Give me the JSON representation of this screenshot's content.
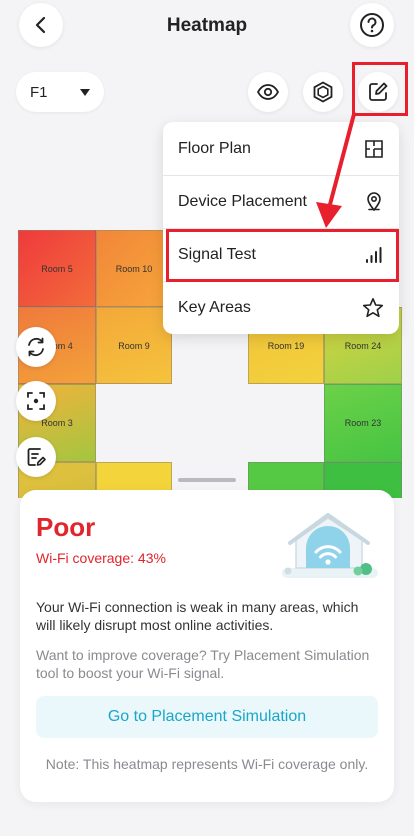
{
  "header": {
    "title": "Heatmap"
  },
  "floor": {
    "selected": "F1"
  },
  "menu": {
    "items": [
      {
        "label": "Floor Plan",
        "icon": "floor-plan-icon"
      },
      {
        "label": "Device Placement",
        "icon": "location-pin-icon"
      },
      {
        "label": "Signal Test",
        "icon": "signal-bars-icon"
      },
      {
        "label": "Key Areas",
        "icon": "star-icon"
      }
    ]
  },
  "rooms": {
    "room5": "Room 5",
    "room10": "Room 10",
    "room4": "Room 4",
    "room9": "Room 9",
    "room3": "Room 3",
    "room19": "Room 19",
    "room24": "Room 24",
    "room23": "Room 23"
  },
  "card": {
    "status": "Poor",
    "coverage": "Wi-Fi coverage: 43%",
    "description": "Your Wi-Fi connection is weak in many areas, which will likely disrupt most online activities.",
    "hint": "Want to improve coverage? Try Placement Simulation tool to boost your Wi-Fi signal.",
    "cta": "Go to Placement Simulation",
    "note": "Note: This heatmap represents Wi-Fi coverage only."
  },
  "colors": {
    "accent": "#1aa6c8",
    "poor": "#e0252c",
    "highlight": "#e8202e"
  }
}
